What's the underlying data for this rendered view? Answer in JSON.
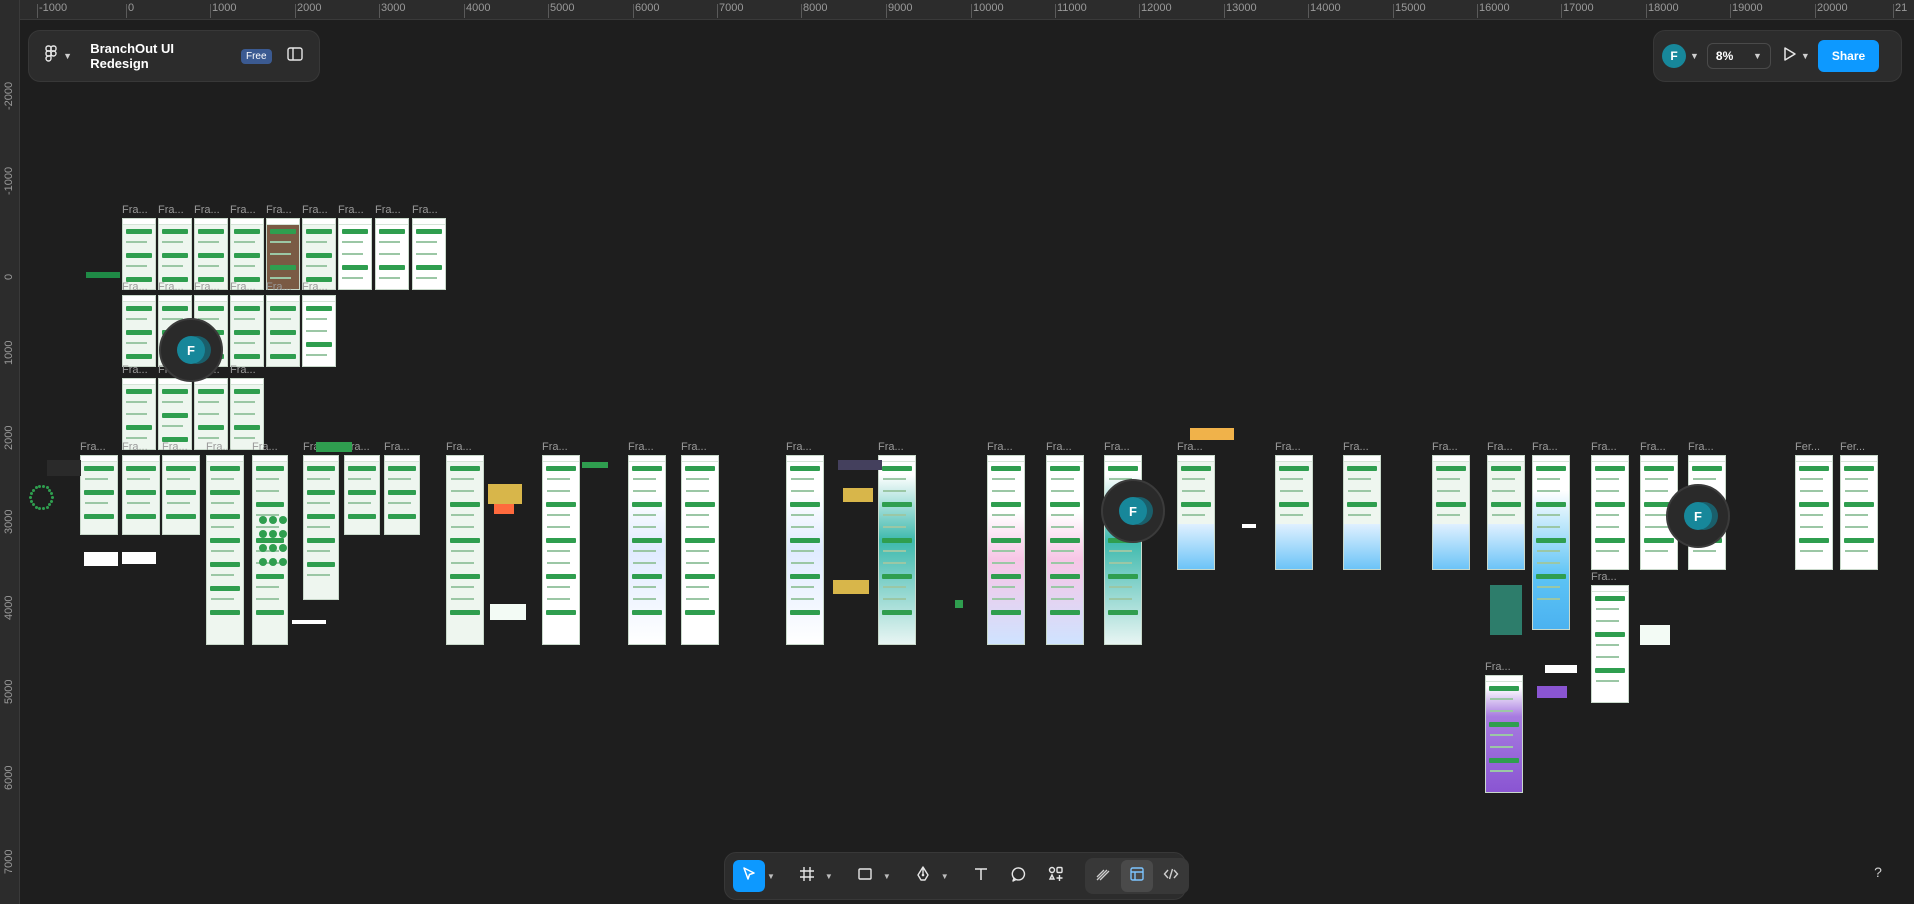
{
  "file": {
    "title": "BranchOut UI Redesign",
    "plan_badge": "Free"
  },
  "header_right": {
    "user_initial": "F",
    "zoom": "8%",
    "share_label": "Share"
  },
  "cursors": [
    {
      "initial": "F"
    },
    {
      "initial": "F"
    },
    {
      "initial": "F"
    }
  ],
  "ruler": {
    "top_ticks": [
      "-1000",
      "0",
      "1000",
      "2000",
      "3000",
      "4000",
      "5000",
      "6000",
      "7000",
      "8000",
      "9000",
      "10000",
      "11000",
      "12000",
      "13000",
      "14000",
      "15000",
      "16000",
      "17000",
      "18000",
      "19000",
      "20000",
      "21"
    ],
    "left_ticks": [
      "-2000",
      "-1000",
      "0",
      "1000",
      "2000",
      "3000",
      "4000",
      "5000",
      "6000",
      "7000"
    ]
  },
  "frame_label": "Fra...",
  "frame_label_alt": "Fer...",
  "toolbar": {
    "tools": [
      "move-tool",
      "frame-tool",
      "shape-tool",
      "pen-tool",
      "text-tool",
      "comment-tool",
      "actions-tool"
    ],
    "modes": [
      "draw-mode",
      "design-mode",
      "dev-mode"
    ]
  },
  "help_label": "?",
  "colors": {
    "accent": "#0d99ff",
    "canvas": "#1e1e1e",
    "panel": "#2c2c2c",
    "frame_green": "#2f9e4f",
    "avatar": "#17879a",
    "badge": "#3b5a91"
  }
}
